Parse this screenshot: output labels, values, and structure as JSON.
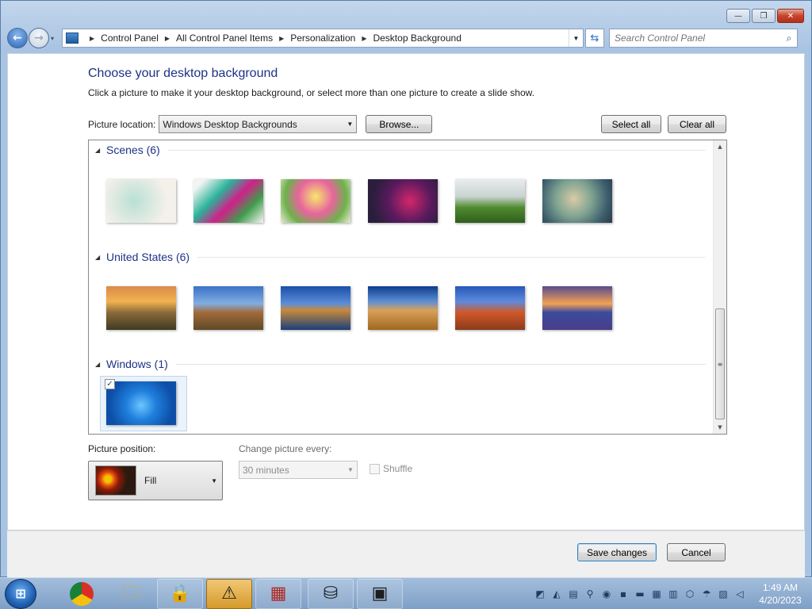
{
  "window": {
    "caption": {
      "minimize": "—",
      "maximize": "❐",
      "close": "✕"
    }
  },
  "nav": {
    "back": "←",
    "forward": "→",
    "breadcrumbs": [
      "Control Panel",
      "All Control Panel Items",
      "Personalization",
      "Desktop Background"
    ],
    "search_placeholder": "Search Control Panel"
  },
  "page": {
    "title": "Choose your desktop background",
    "subtitle": "Click a picture to make it your desktop background, or select more than one picture to create a slide show.",
    "location_label": "Picture location:",
    "location_value": "Windows Desktop Backgrounds",
    "browse": "Browse...",
    "select_all": "Select all",
    "clear_all": "Clear all"
  },
  "gallery": {
    "groups": [
      {
        "name": "Scenes (6)",
        "thumbs": [
          "scene-1",
          "scene-2",
          "scene-3",
          "scene-4",
          "scene-5",
          "scene-6"
        ]
      },
      {
        "name": "United States (6)",
        "thumbs": [
          "us-1",
          "us-2",
          "us-3",
          "us-4",
          "us-5",
          "us-6"
        ]
      },
      {
        "name": "Windows (1)",
        "thumbs": [
          "windows-7"
        ],
        "selected": true
      }
    ],
    "checkmark": "✓"
  },
  "options": {
    "position_label": "Picture position:",
    "position_value": "Fill",
    "change_label": "Change picture every:",
    "change_value": "30 minutes",
    "shuffle": "Shuffle"
  },
  "footer": {
    "save": "Save changes",
    "cancel": "Cancel"
  },
  "taskbar": {
    "apps": [
      "chrome-icon",
      "explorer-icon",
      "security-icon",
      "warning-icon",
      "media-icon",
      "drive-icon",
      "control-panel-icon"
    ],
    "time": "1:49 AM",
    "date": "4/20/2023"
  },
  "colors": {
    "title": "#1e3287",
    "taskbar": "#7e9fc6",
    "accent": "#3c7fb1"
  }
}
